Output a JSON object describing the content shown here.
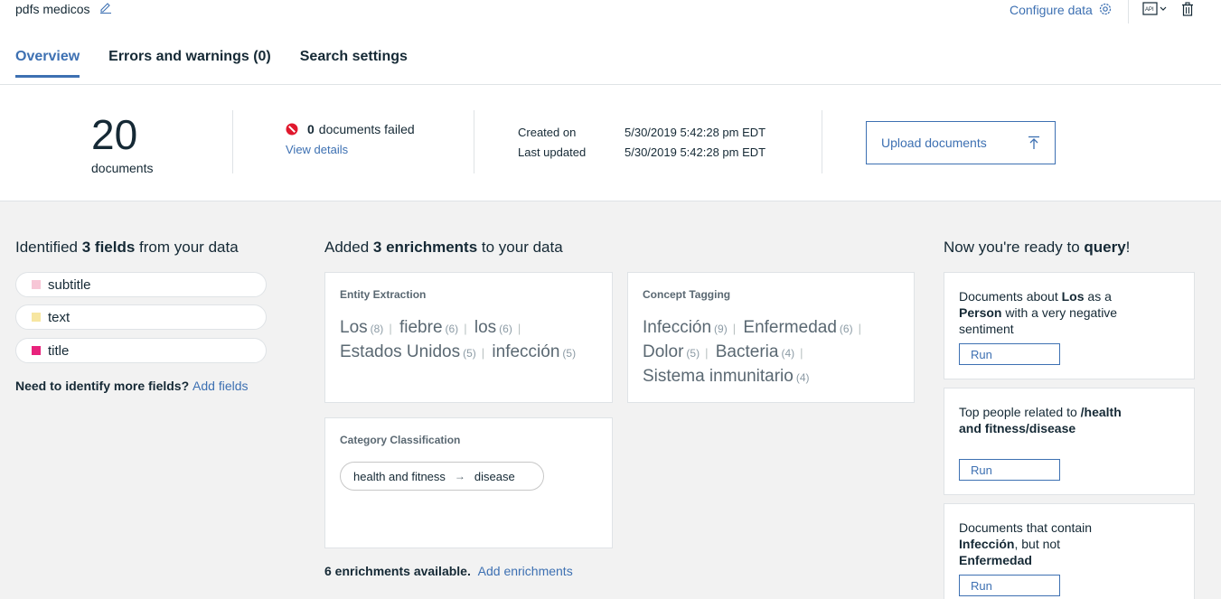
{
  "header": {
    "collection_name": "pdfs medicos",
    "configure_label": "Configure data",
    "icons": [
      "pencil-icon",
      "gear-icon",
      "api-icon",
      "trash-icon"
    ]
  },
  "tabs": [
    {
      "label": "Overview",
      "active": true
    },
    {
      "label": "Errors and warnings (0)",
      "active": false
    },
    {
      "label": "Search settings",
      "active": false
    }
  ],
  "stats": {
    "doc_count": "20",
    "doc_label": "documents",
    "failed_count": "0",
    "failed_label": "documents failed",
    "view_details": "View details",
    "created_label": "Created on",
    "created_value": "5/30/2019 5:42:28 pm EDT",
    "updated_label": "Last updated",
    "updated_value": "5/30/2019 5:42:28 pm EDT",
    "upload_label": "Upload documents"
  },
  "fields_section": {
    "title_pre": "Identified ",
    "title_bold": "3 fields",
    "title_post": " from your data",
    "fields": [
      {
        "name": "subtitle",
        "color": "#f7c6d6"
      },
      {
        "name": "text",
        "color": "#f7e6a1"
      },
      {
        "name": "title",
        "color": "#e8237c"
      }
    ],
    "need_more": "Need to identify more fields?",
    "add_fields": "Add fields"
  },
  "enrichments_section": {
    "title_pre": "Added ",
    "title_bold": "3 enrichments",
    "title_post": " to your data",
    "entity": {
      "title": "Entity Extraction",
      "items": [
        {
          "term": "Los",
          "count": "(8)"
        },
        {
          "term": "fiebre",
          "count": "(6)"
        },
        {
          "term": "los",
          "count": "(6)"
        },
        {
          "term": "Estados Unidos",
          "count": "(5)"
        },
        {
          "term": "infección",
          "count": "(5)"
        }
      ]
    },
    "concept": {
      "title": "Concept Tagging",
      "items": [
        {
          "term": "Infección",
          "count": "(9)"
        },
        {
          "term": "Enfermedad",
          "count": "(6)"
        },
        {
          "term": "Dolor",
          "count": "(5)"
        },
        {
          "term": "Bacteria",
          "count": "(4)"
        },
        {
          "term": "Sistema inmunitario",
          "count": "(4)"
        }
      ]
    },
    "category": {
      "title": "Category Classification",
      "path_from": "health and fitness",
      "path_to": "disease"
    },
    "available": "6 enrichments available.",
    "add_enrichments": "Add enrichments"
  },
  "query_section": {
    "title_pre": "Now you're ready to ",
    "title_bold": "query",
    "title_post": "!",
    "run_label": "Run",
    "queries": [
      {
        "parts": [
          [
            "Documents about ",
            false
          ],
          [
            "Los",
            true
          ],
          [
            " as a ",
            false
          ],
          [
            "Person",
            true
          ],
          [
            " with a very negative sentiment",
            false
          ]
        ]
      },
      {
        "parts": [
          [
            "Top people related to ",
            false
          ],
          [
            "/health and fitness/disease",
            true
          ]
        ]
      },
      {
        "parts": [
          [
            "Documents that contain ",
            false
          ],
          [
            "Infección",
            true
          ],
          [
            ", but not ",
            false
          ],
          [
            "Enfermedad",
            true
          ]
        ]
      }
    ]
  }
}
